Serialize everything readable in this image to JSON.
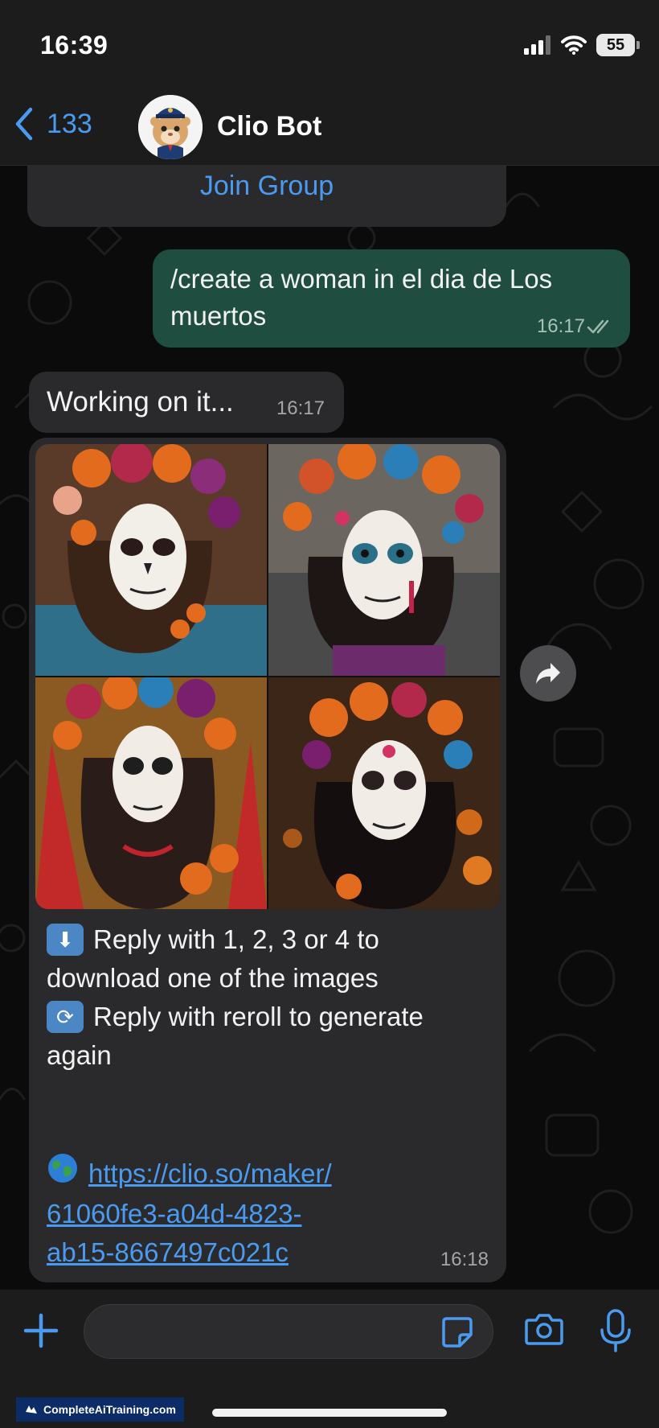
{
  "status_bar": {
    "time": "16:39",
    "battery": "55"
  },
  "header": {
    "back_count": "133",
    "contact_name": "Clio Bot"
  },
  "messages": {
    "join": {
      "label": "Join Group"
    },
    "create": {
      "text": "/create a woman in el dia de Los muertos",
      "time": "16:17"
    },
    "working": {
      "text": "Working on it...",
      "time": "16:17"
    },
    "image": {
      "line1": "Reply with 1, 2, 3 or 4 to",
      "line2": "download one of the images",
      "line3": "Reply with reroll to generate",
      "line4": "again",
      "link_line1": "https://clio.so/maker/",
      "link_line2": "61060fe3-a04d-4823-",
      "link_line3": "ab15-8667497c021c",
      "time": "16:18"
    }
  },
  "icons": {
    "back": "chevron-left-icon",
    "forward": "forward-arrow-icon",
    "plus": "plus-icon",
    "sticker": "sticker-icon",
    "camera": "camera-icon",
    "mic": "microphone-icon",
    "download": "down-arrow-emoji",
    "reroll": "repeat-emoji",
    "globe": "globe-emoji"
  },
  "colors": {
    "accent": "#4a9bf0",
    "incoming_bubble": "#2a2a2c",
    "outgoing_bubble": "#1f4d3f",
    "background": "#0b0b0b"
  },
  "watermark": "CompleteAiTraining.com"
}
